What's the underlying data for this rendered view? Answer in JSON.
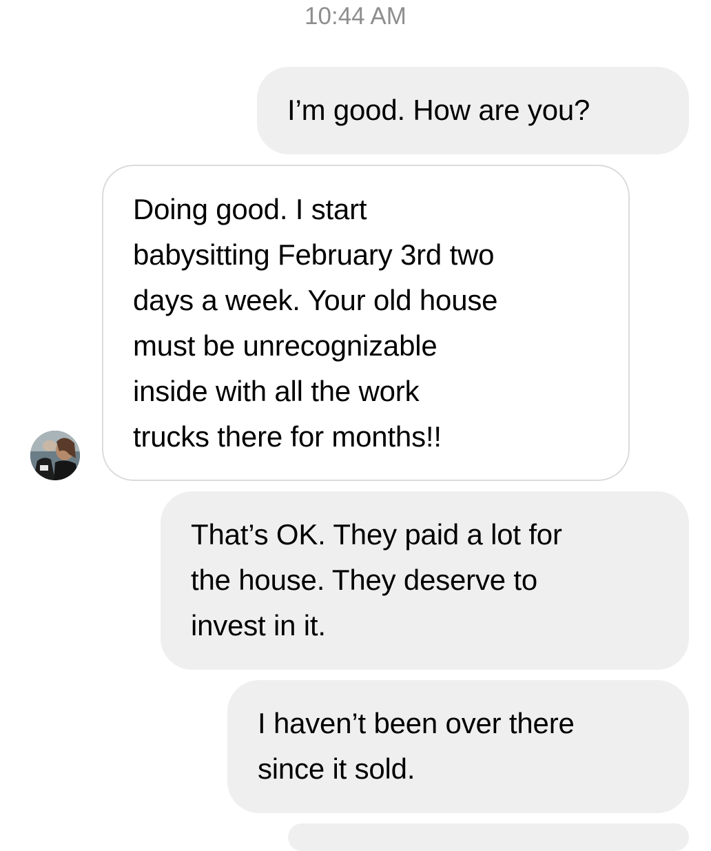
{
  "thread": {
    "timestamp": "10:44 AM",
    "contact_avatar_icon": "profile-photo-avatar",
    "messages": [
      {
        "sender": "me",
        "text": "I’m good. How are you?"
      },
      {
        "sender": "contact",
        "text": "Doing good. I start\nbabysitting February 3rd two\ndays a week. Your old house\nmust be unrecognizable\ninside with all the work\ntrucks there for months!!"
      },
      {
        "sender": "me",
        "text": "That’s OK. They paid a lot for\nthe house. They deserve to\ninvest in it."
      },
      {
        "sender": "me",
        "text": "I haven’t been over there\nsince it sold."
      }
    ]
  },
  "colors": {
    "outgoing_bubble": "#efefef",
    "incoming_border": "#dbdbdb",
    "timestamp_text": "#8e8e8e"
  }
}
